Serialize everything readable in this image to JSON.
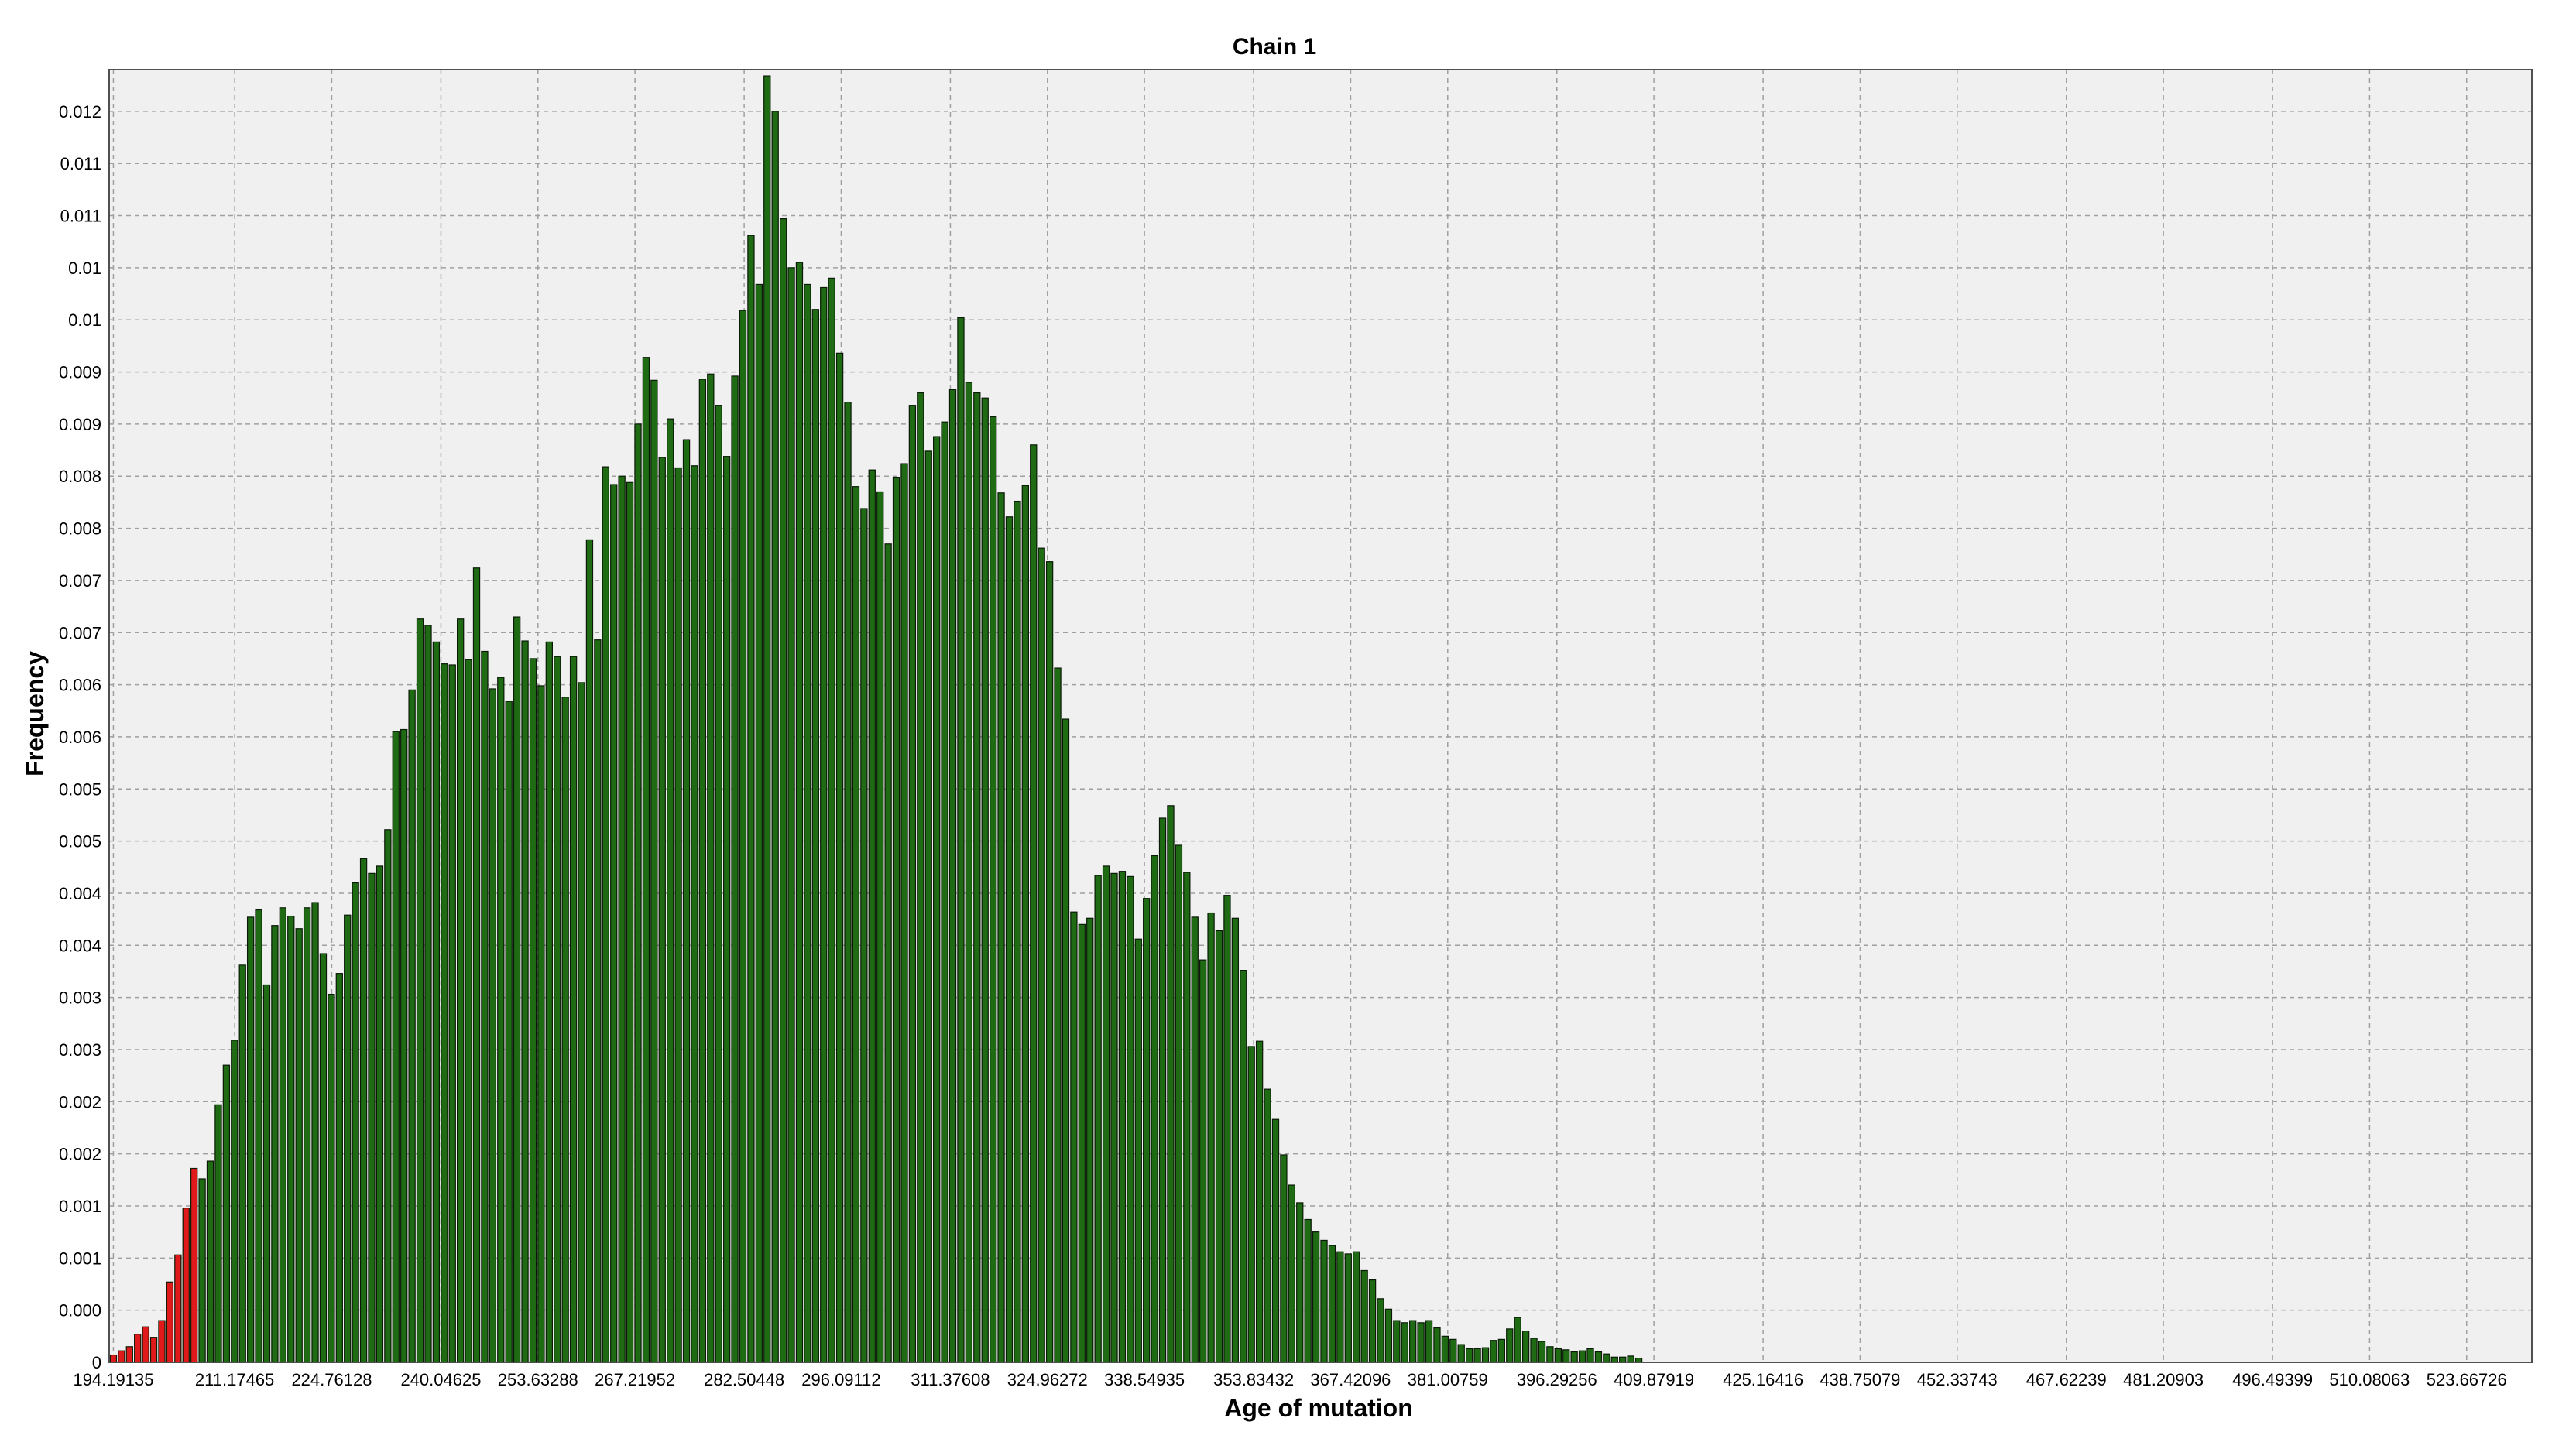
{
  "chart_data": {
    "type": "bar",
    "title": "Chain 1",
    "xlabel": "Age of mutation",
    "ylabel": "Frequency",
    "xlim": [
      193.6,
      532.8
    ],
    "ylim": [
      0,
      0.0124
    ],
    "bin_width": 1.13,
    "grid": true,
    "legend": "none",
    "colors": {
      "bar_in": "#1e6b14",
      "bar_out": "#e01a1a",
      "bar_edge": "#0a1a06",
      "grid": "#a0a0a0",
      "background": "#f0f0f0"
    },
    "xticks": [
      {
        "value": 194.19135,
        "label": "194.19135"
      },
      {
        "value": 211.17465,
        "label": "211.17465"
      },
      {
        "value": 224.76128,
        "label": "224.76128"
      },
      {
        "value": 240.04625,
        "label": "240.04625"
      },
      {
        "value": 253.63288,
        "label": "253.63288"
      },
      {
        "value": 267.21952,
        "label": "267.21952"
      },
      {
        "value": 282.50448,
        "label": "282.50448"
      },
      {
        "value": 296.09112,
        "label": "296.09112"
      },
      {
        "value": 311.37608,
        "label": "311.37608"
      },
      {
        "value": 324.96272,
        "label": "324.96272"
      },
      {
        "value": 338.54935,
        "label": "338.54935"
      },
      {
        "value": 353.83432,
        "label": "353.83432"
      },
      {
        "value": 367.42096,
        "label": "367.42096"
      },
      {
        "value": 381.00759,
        "label": "381.00759"
      },
      {
        "value": 396.29256,
        "label": "396.29256"
      },
      {
        "value": 409.87919,
        "label": "409.87919"
      },
      {
        "value": 425.16416,
        "label": "425.16416"
      },
      {
        "value": 438.75079,
        "label": "438.75079"
      },
      {
        "value": 452.33743,
        "label": "452.33743"
      },
      {
        "value": 467.62239,
        "label": "467.62239"
      },
      {
        "value": 481.20903,
        "label": "481.20903"
      },
      {
        "value": 496.49399,
        "label": "496.49399"
      },
      {
        "value": 510.08063,
        "label": "510.08063"
      },
      {
        "value": 523.66726,
        "label": "523.66726"
      }
    ],
    "yticks": [
      {
        "value": 0,
        "label": "0"
      },
      {
        "value": 0.0005,
        "label": "0.000"
      },
      {
        "value": 0.001,
        "label": "0.001"
      },
      {
        "value": 0.0015,
        "label": "0.001"
      },
      {
        "value": 0.002,
        "label": "0.002"
      },
      {
        "value": 0.0025,
        "label": "0.002"
      },
      {
        "value": 0.003,
        "label": "0.003"
      },
      {
        "value": 0.0035,
        "label": "0.003"
      },
      {
        "value": 0.004,
        "label": "0.004"
      },
      {
        "value": 0.0045,
        "label": "0.004"
      },
      {
        "value": 0.005,
        "label": "0.005"
      },
      {
        "value": 0.0055,
        "label": "0.005"
      },
      {
        "value": 0.006,
        "label": "0.006"
      },
      {
        "value": 0.0065,
        "label": "0.006"
      },
      {
        "value": 0.007,
        "label": "0.007"
      },
      {
        "value": 0.0075,
        "label": "0.007"
      },
      {
        "value": 0.008,
        "label": "0.008"
      },
      {
        "value": 0.0085,
        "label": "0.008"
      },
      {
        "value": 0.009,
        "label": "0.009"
      },
      {
        "value": 0.0095,
        "label": "0.009"
      },
      {
        "value": 0.01,
        "label": "0.01"
      },
      {
        "value": 0.0105,
        "label": "0.01"
      },
      {
        "value": 0.011,
        "label": "0.011"
      },
      {
        "value": 0.0115,
        "label": "0.011"
      },
      {
        "value": 0.012,
        "label": "0.012"
      }
    ],
    "x_start": 194.19,
    "inside_range": [
      206.6,
      454.6
    ],
    "values": [
      7e-05,
      0.00011,
      0.00015,
      0.00027,
      0.00034,
      0.00024,
      0.0004,
      0.00077,
      0.00103,
      0.00148,
      0.00186,
      0.00176,
      0.00193,
      0.00247,
      0.00285,
      0.00309,
      0.00381,
      0.00427,
      0.00434,
      0.00362,
      0.00419,
      0.00436,
      0.00428,
      0.00416,
      0.00436,
      0.00441,
      0.00392,
      0.00353,
      0.00373,
      0.00429,
      0.0046,
      0.00483,
      0.00469,
      0.00476,
      0.00511,
      0.00605,
      0.00607,
      0.00645,
      0.00713,
      0.00707,
      0.00691,
      0.0067,
      0.00669,
      0.00713,
      0.00674,
      0.00762,
      0.00682,
      0.00646,
      0.00657,
      0.00634,
      0.00715,
      0.00692,
      0.00675,
      0.00649,
      0.00691,
      0.00677,
      0.00638,
      0.00677,
      0.00652,
      0.00789,
      0.00693,
      0.00859,
      0.00842,
      0.0085,
      0.00844,
      0.009,
      0.00964,
      0.00942,
      0.00868,
      0.00905,
      0.00858,
      0.00885,
      0.0086,
      0.00943,
      0.00948,
      0.00918,
      0.00869,
      0.00946,
      0.01009,
      0.01081,
      0.01034,
      0.01234,
      0.012,
      0.01097,
      0.0105,
      0.01055,
      0.01034,
      0.0101,
      0.01031,
      0.0104,
      0.00968,
      0.00921,
      0.0084,
      0.00819,
      0.00856,
      0.00835,
      0.00785,
      0.00849,
      0.00862,
      0.00918,
      0.0093,
      0.00874,
      0.00888,
      0.00902,
      0.00933,
      0.01002,
      0.0094,
      0.0093,
      0.00925,
      0.00907,
      0.00834,
      0.00811,
      0.00826,
      0.00841,
      0.0088,
      0.00781,
      0.00768,
      0.00666,
      0.00617,
      0.00432,
      0.0042,
      0.00426,
      0.00467,
      0.00476,
      0.00469,
      0.00471,
      0.00466,
      0.00406,
      0.00445,
      0.00486,
      0.00522,
      0.00534,
      0.00496,
      0.0047,
      0.00427,
      0.00386,
      0.00431,
      0.00414,
      0.00448,
      0.00426,
      0.00376,
      0.00303,
      0.00308,
      0.00262,
      0.00233,
      0.00199,
      0.0017,
      0.00153,
      0.00137,
      0.00125,
      0.00117,
      0.00112,
      0.00106,
      0.00104,
      0.00106,
      0.00088,
      0.00079,
      0.00061,
      0.00051,
      0.0004,
      0.00038,
      0.0004,
      0.00038,
      0.0004,
      0.00033,
      0.00025,
      0.00022,
      0.00017,
      0.00013,
      0.00013,
      0.00014,
      0.00021,
      0.00022,
      0.00032,
      0.00043,
      0.0003,
      0.00023,
      0.0002,
      0.00015,
      0.00013,
      0.00012,
      0.0001,
      0.00011,
      0.00013,
      0.0001,
      8e-05,
      5e-05,
      5e-05,
      6e-05,
      4e-05
    ]
  }
}
